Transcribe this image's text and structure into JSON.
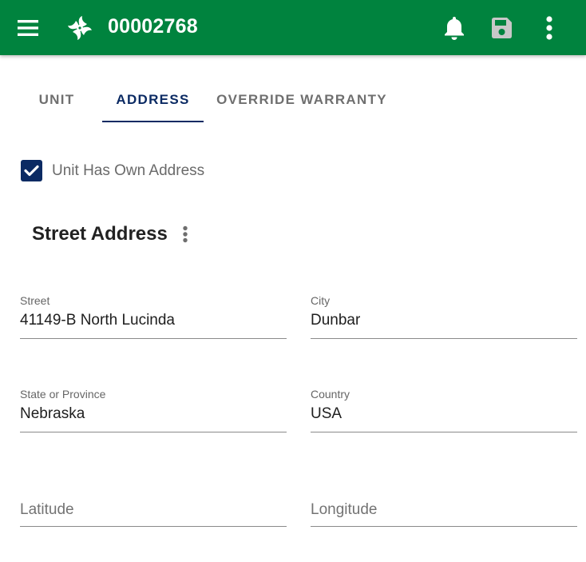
{
  "appbar": {
    "title": "00002768",
    "color": "#00833e",
    "icons": {
      "menu": "hamburger-menu-icon",
      "logo": "pinwheel-logo-icon",
      "notifications": "bell-icon",
      "save": "floppy-save-icon",
      "more": "more-vertical-icon"
    }
  },
  "tabs": [
    {
      "label": "UNIT",
      "active": false
    },
    {
      "label": "ADDRESS",
      "active": true
    },
    {
      "label": "OVERRIDE WARRANTY",
      "active": false
    }
  ],
  "accent_color": "#0b2a63",
  "unit_has_own_address": {
    "label": "Unit Has Own Address",
    "checked": true
  },
  "section": {
    "title": "Street Address"
  },
  "fields": {
    "street": {
      "label": "Street",
      "value": "41149-B North Lucinda"
    },
    "city": {
      "label": "City",
      "value": "Dunbar"
    },
    "state": {
      "label": "State or Province",
      "value": "Nebraska"
    },
    "country": {
      "label": "Country",
      "value": "USA"
    },
    "latitude": {
      "placeholder": "Latitude",
      "value": ""
    },
    "longitude": {
      "placeholder": "Longitude",
      "value": ""
    }
  }
}
